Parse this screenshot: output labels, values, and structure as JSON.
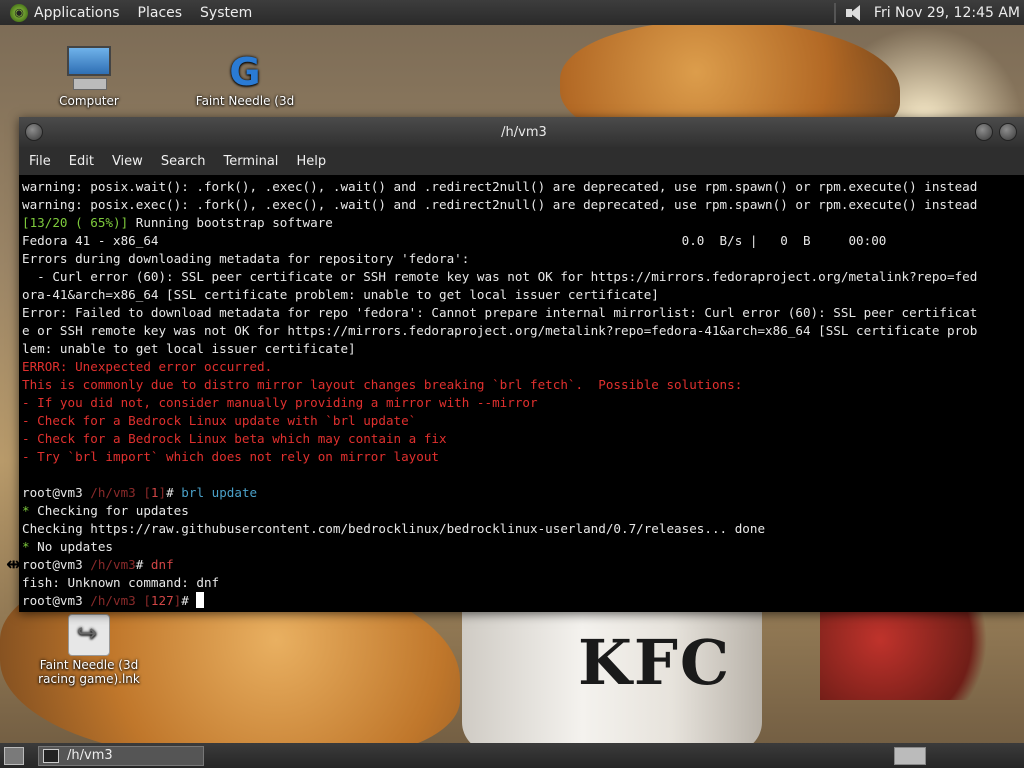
{
  "top_panel": {
    "menus": [
      "Applications",
      "Places",
      "System"
    ],
    "clock": "Fri Nov 29, 12:45 AM"
  },
  "desktop": {
    "icons": [
      {
        "label": "Computer",
        "icon": "computer-icon"
      },
      {
        "label": "Faint Needle (3d",
        "icon": "g-app-icon"
      },
      {
        "label": "Faint Needle (3d racing game).lnk",
        "icon": "shortcut-icon"
      }
    ],
    "wallpaper_text": "KFC"
  },
  "terminal": {
    "title": "/h/vm3",
    "menu": [
      "File",
      "Edit",
      "View",
      "Search",
      "Terminal",
      "Help"
    ],
    "lines": [
      {
        "segments": [
          {
            "t": "warning: posix.wait(): .fork(), .exec(), .wait() and .redirect2null() are deprecated, use rpm.spawn() or rpm.execute() instead"
          }
        ]
      },
      {
        "segments": [
          {
            "t": "warning: posix.exec(): .fork(), .exec(), .wait() and .redirect2null() are deprecated, use rpm.spawn() or rpm.execute() instead"
          }
        ]
      },
      {
        "segments": [
          {
            "t": "[13/20 ( 65%)]",
            "c": "green"
          },
          {
            "t": " Running bootstrap software"
          }
        ]
      },
      {
        "segments": [
          {
            "t": "Fedora 41 - x86_64                                                                     0.0  B/s |   0  B     00:00"
          }
        ]
      },
      {
        "segments": [
          {
            "t": "Errors during downloading metadata for repository 'fedora':"
          }
        ]
      },
      {
        "segments": [
          {
            "t": "  - Curl error (60): SSL peer certificate or SSH remote key was not OK for https://mirrors.fedoraproject.org/metalink?repo=fed"
          }
        ]
      },
      {
        "segments": [
          {
            "t": "ora-41&arch=x86_64 [SSL certificate problem: unable to get local issuer certificate]"
          }
        ]
      },
      {
        "segments": [
          {
            "t": "Error: Failed to download metadata for repo 'fedora': Cannot prepare internal mirrorlist: Curl error (60): SSL peer certificat"
          }
        ]
      },
      {
        "segments": [
          {
            "t": "e or SSH remote key was not OK for https://mirrors.fedoraproject.org/metalink?repo=fedora-41&arch=x86_64 [SSL certificate prob"
          }
        ]
      },
      {
        "segments": [
          {
            "t": "lem: unable to get local issuer certificate]"
          }
        ]
      },
      {
        "segments": [
          {
            "t": "ERROR: Unexpected error occurred.",
            "c": "red"
          }
        ]
      },
      {
        "segments": [
          {
            "t": "This is commonly due to distro mirror layout changes breaking `brl fetch`.  Possible solutions:",
            "c": "red"
          }
        ]
      },
      {
        "segments": [
          {
            "t": "- If you did not, consider manually providing a mirror with --mirror",
            "c": "red"
          }
        ]
      },
      {
        "segments": [
          {
            "t": "- Check for a Bedrock Linux update with `brl update`",
            "c": "red"
          }
        ]
      },
      {
        "segments": [
          {
            "t": "- Check for a Bedrock Linux beta which may contain a fix",
            "c": "red"
          }
        ]
      },
      {
        "segments": [
          {
            "t": "- Try `brl import` which does not rely on mirror layout",
            "c": "red"
          }
        ]
      },
      {
        "segments": [
          {
            "t": ""
          }
        ]
      },
      {
        "segments": [
          {
            "t": "root@vm3 "
          },
          {
            "t": "/h/vm3",
            "c": "dimred"
          },
          {
            "t": " [",
            "c": "dimred"
          },
          {
            "t": "1",
            "c": "pink"
          },
          {
            "t": "]",
            "c": "dimred"
          },
          {
            "t": "# "
          },
          {
            "t": "brl update",
            "c": "cyanc"
          }
        ]
      },
      {
        "segments": [
          {
            "t": "* ",
            "c": "green"
          },
          {
            "t": "Checking for updates"
          }
        ]
      },
      {
        "segments": [
          {
            "t": "Checking https://raw.githubusercontent.com/bedrocklinux/bedrocklinux-userland/0.7/releases... done"
          }
        ]
      },
      {
        "segments": [
          {
            "t": "* ",
            "c": "green"
          },
          {
            "t": "No updates"
          }
        ]
      },
      {
        "segments": [
          {
            "t": "root@vm3 "
          },
          {
            "t": "/h/vm3",
            "c": "dimred"
          },
          {
            "t": "# "
          },
          {
            "t": "dnf",
            "c": "pink"
          }
        ]
      },
      {
        "segments": [
          {
            "t": "fish: Unknown command: dnf"
          }
        ]
      },
      {
        "segments": [
          {
            "t": "root@vm3 "
          },
          {
            "t": "/h/vm3",
            "c": "dimred"
          },
          {
            "t": " [",
            "c": "dimred"
          },
          {
            "t": "127",
            "c": "pink"
          },
          {
            "t": "]",
            "c": "dimred"
          },
          {
            "t": "# "
          }
        ],
        "cursor": true
      }
    ]
  },
  "bottom_panel": {
    "task_label": "/h/vm3"
  }
}
